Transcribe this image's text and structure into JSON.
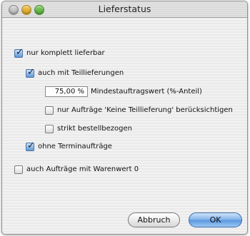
{
  "window": {
    "title": "Lieferstatus"
  },
  "options": {
    "nur_komplett": {
      "label": "nur komplett lieferbar",
      "checked": true
    },
    "teillieferungen": {
      "label": "auch mit Teillieferungen",
      "checked": true
    },
    "mindestauftrag": {
      "value": "75,00 %",
      "label": "Mindestauftragswert (%-Anteil)"
    },
    "keine_teillieferung": {
      "label": "nur Aufträge 'Keine Teillieferung' berücksichtigen",
      "checked": false
    },
    "strikt": {
      "label": "strikt bestellbezogen",
      "checked": false
    },
    "ohne_termin": {
      "label": "ohne Terminaufträge",
      "checked": true
    },
    "warenwert_null": {
      "label": "auch Aufträge mit Warenwert 0",
      "checked": false
    }
  },
  "buttons": {
    "cancel": "Abbruch",
    "ok": "OK"
  }
}
